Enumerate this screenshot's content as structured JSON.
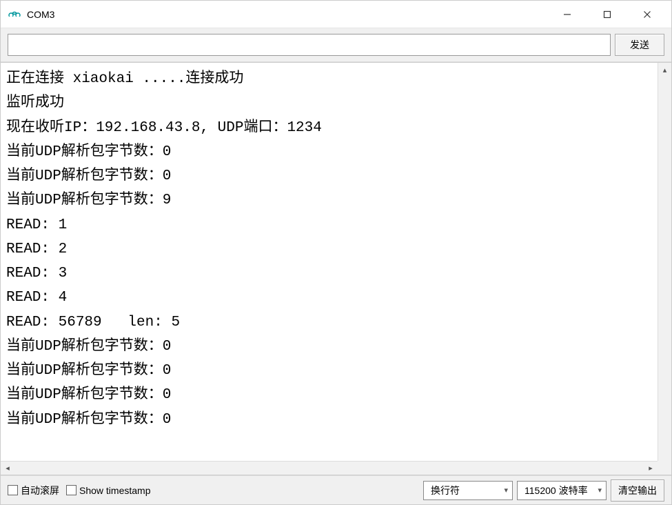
{
  "title": "COM3",
  "input": {
    "value": "",
    "send_label": "发送"
  },
  "console_lines": [
    "正在连接 xiaokai .....连接成功",
    "监听成功",
    "现在收听IP：192.168.43.8, UDP端口：1234",
    "当前UDP解析包字节数：0",
    "当前UDP解析包字节数：0",
    "当前UDP解析包字节数：9",
    "READ: 1",
    "READ: 2",
    "READ: 3",
    "READ: 4",
    "READ: 56789   len: 5",
    "当前UDP解析包字节数：0",
    "当前UDP解析包字节数：0",
    "当前UDP解析包字节数：0",
    "当前UDP解析包字节数：0"
  ],
  "footer": {
    "autoscroll_label": "自动滚屏",
    "show_timestamp_label": "Show timestamp",
    "line_ending": "换行符",
    "baud_rate": "115200 波特率",
    "clear_output_label": "清空输出"
  }
}
